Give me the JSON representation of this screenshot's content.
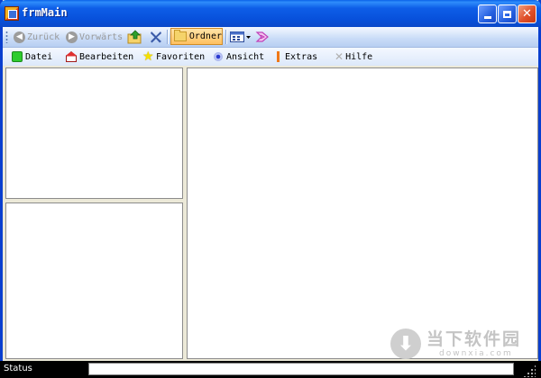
{
  "window": {
    "title": "frmMain"
  },
  "toolbar": {
    "back_label": "Zurück",
    "forward_label": "Vorwärts",
    "folder_label": "Ordner"
  },
  "menu": {
    "items": [
      {
        "label": "Datei",
        "icon": "green-square-icon"
      },
      {
        "label": "Bearbeiten",
        "icon": "house-icon"
      },
      {
        "label": "Favoriten",
        "icon": "star-icon"
      },
      {
        "label": "Ansicht",
        "icon": "eye-icon"
      },
      {
        "label": "Extras",
        "icon": "pencil-icon"
      },
      {
        "label": "Hilfe",
        "icon": "help-icon"
      }
    ]
  },
  "statusbar": {
    "label": "Status"
  },
  "watermark": {
    "title": "当下软件园",
    "subtitle": "downxia.com"
  },
  "colors": {
    "titlebar": "#0851dc",
    "toolbar": "#c8dbf7",
    "folder_button": "#ffc060",
    "statusbar": "#000000"
  }
}
